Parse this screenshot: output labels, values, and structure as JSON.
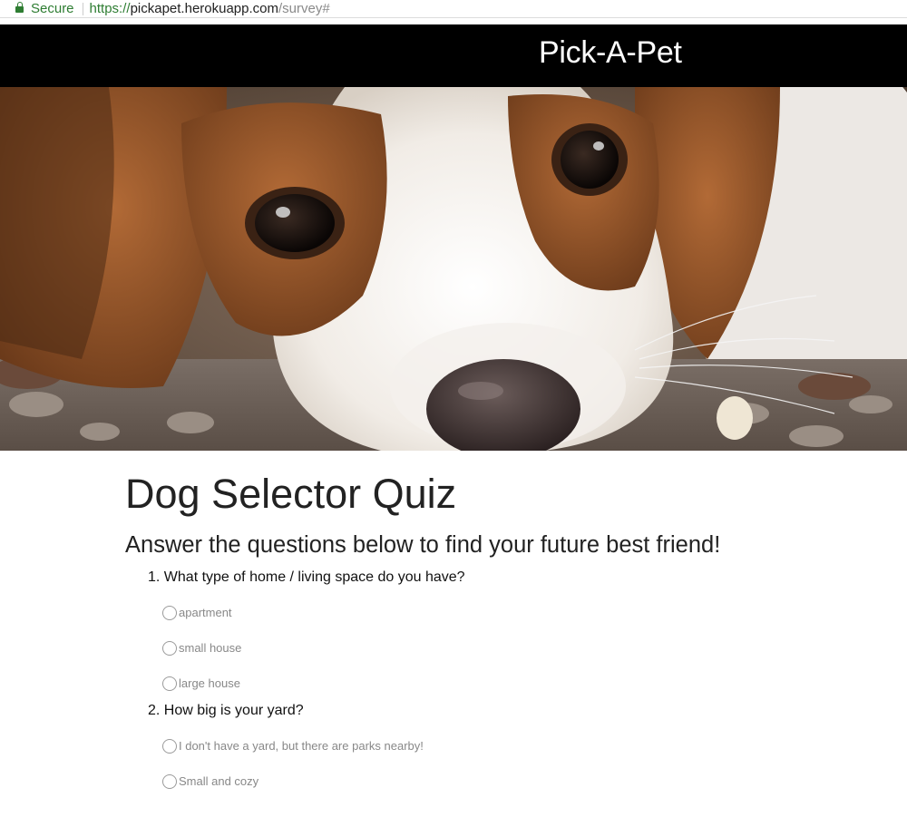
{
  "urlbar": {
    "secure_label": "Secure",
    "url_protocol": "https://",
    "url_host": "pickapet.herokuapp.com",
    "url_path": "/survey#"
  },
  "header": {
    "brand": "Pick-A-Pet"
  },
  "hero": {
    "icon": "beagle-puppy-photo"
  },
  "main": {
    "title": "Dog Selector Quiz",
    "subtitle": "Answer the questions below to find your future best friend!",
    "questions": [
      {
        "number": "1.",
        "text": "What type of home / living space do you have?",
        "options": [
          "apartment",
          "small house",
          "large house"
        ]
      },
      {
        "number": "2.",
        "text": "How big is your yard?",
        "options": [
          "I don't have a yard, but there are parks nearby!",
          "Small and cozy"
        ]
      }
    ]
  },
  "colors": {
    "secure_green": "#2e7d32",
    "navbar_bg": "#000000",
    "brand_text": "#ffffff",
    "option_text": "#888888"
  }
}
